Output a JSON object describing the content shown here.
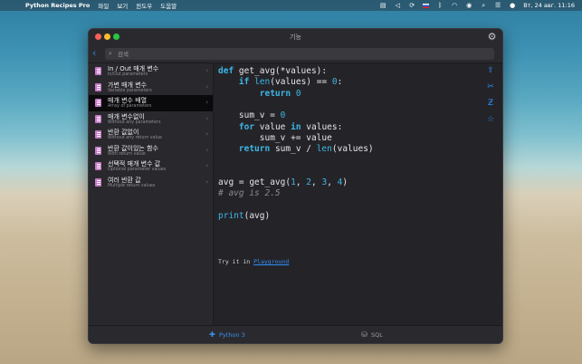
{
  "menubar": {
    "app_name": "Python Recipes Pro",
    "menus": [
      "파일",
      "보기",
      "윈도우",
      "도움말"
    ],
    "clock": "Вт, 24 авг.  11:16"
  },
  "window": {
    "title": "기능",
    "search_placeholder": "검색"
  },
  "sidebar": {
    "items": [
      {
        "title": "In / Out 매개 변수",
        "subtitle": "In/Out parameters"
      },
      {
        "title": "가변 매개 변수",
        "subtitle": "Variable parameters"
      },
      {
        "title": "매개 변수 배열",
        "subtitle": "Array of parameters"
      },
      {
        "title": "매개 변수없이",
        "subtitle": "Without any parameters"
      },
      {
        "title": "반환 값없이",
        "subtitle": "Without any return value"
      },
      {
        "title": "반환 값이있는 함수",
        "subtitle": "With return value"
      },
      {
        "title": "선택적 매개 변수 값",
        "subtitle": "Optional parameter values"
      },
      {
        "title": "여러 반환 값",
        "subtitle": "Multiple return values"
      }
    ],
    "selected_index": 2
  },
  "code": {
    "lines": [
      "def get_avg(*values):",
      "    if len(values) == 0:",
      "        return 0",
      "",
      "    sum_v = 0",
      "    for value in values:",
      "        sum_v += value",
      "    return sum_v / len(values)",
      "",
      "",
      "avg = get_avg(1, 2, 3, 4)",
      "# avg is 2.5",
      "",
      "print(avg)"
    ],
    "try_prefix": "Try it in ",
    "try_link": "Playground"
  },
  "bottom_tabs": {
    "python": "Python 3",
    "sql": "SQL"
  }
}
